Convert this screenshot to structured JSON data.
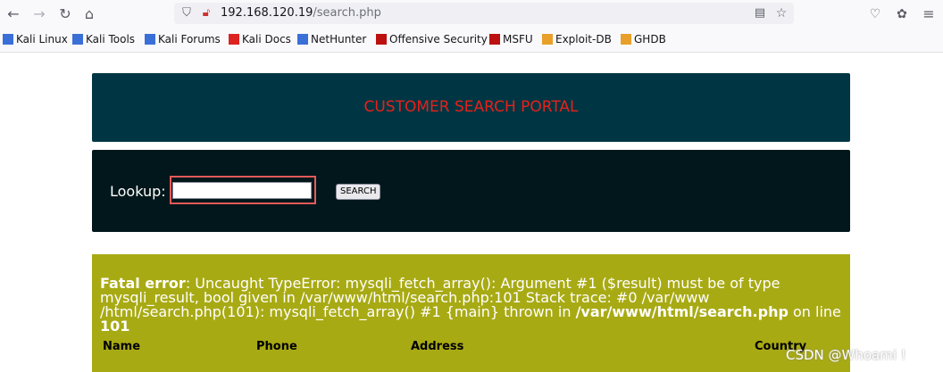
{
  "browser": {
    "url_host": "192.168.120.19",
    "url_path": "/search.php",
    "bookmarks": [
      "Kali Linux",
      "Kali Tools",
      "Kali Forums",
      "Kali Docs",
      "NetHunter",
      "Offensive Security",
      "MSFU",
      "Exploit-DB",
      "GHDB"
    ]
  },
  "banner": {
    "title": "CUSTOMER SEARCH PORTAL"
  },
  "search": {
    "label": "Lookup:",
    "value": "",
    "button_label": "SEARCH"
  },
  "error": {
    "heading": "Fatal error",
    "message": ": Uncaught TypeError: mysqli_fetch_array(): Argument #1 ($result) must be of type mysqli_result, bool given in /var/www/html/search.php:101 Stack trace: #0 /var/www /html/search.php(101): mysqli_fetch_array() #1 {main} thrown in ",
    "file": "/var/www/html/search.php",
    "on_line": " on line ",
    "line": "101"
  },
  "table": {
    "columns": [
      "Name",
      "Phone",
      "Address",
      "Country"
    ]
  },
  "watermark": "CSDN @Whoami !"
}
